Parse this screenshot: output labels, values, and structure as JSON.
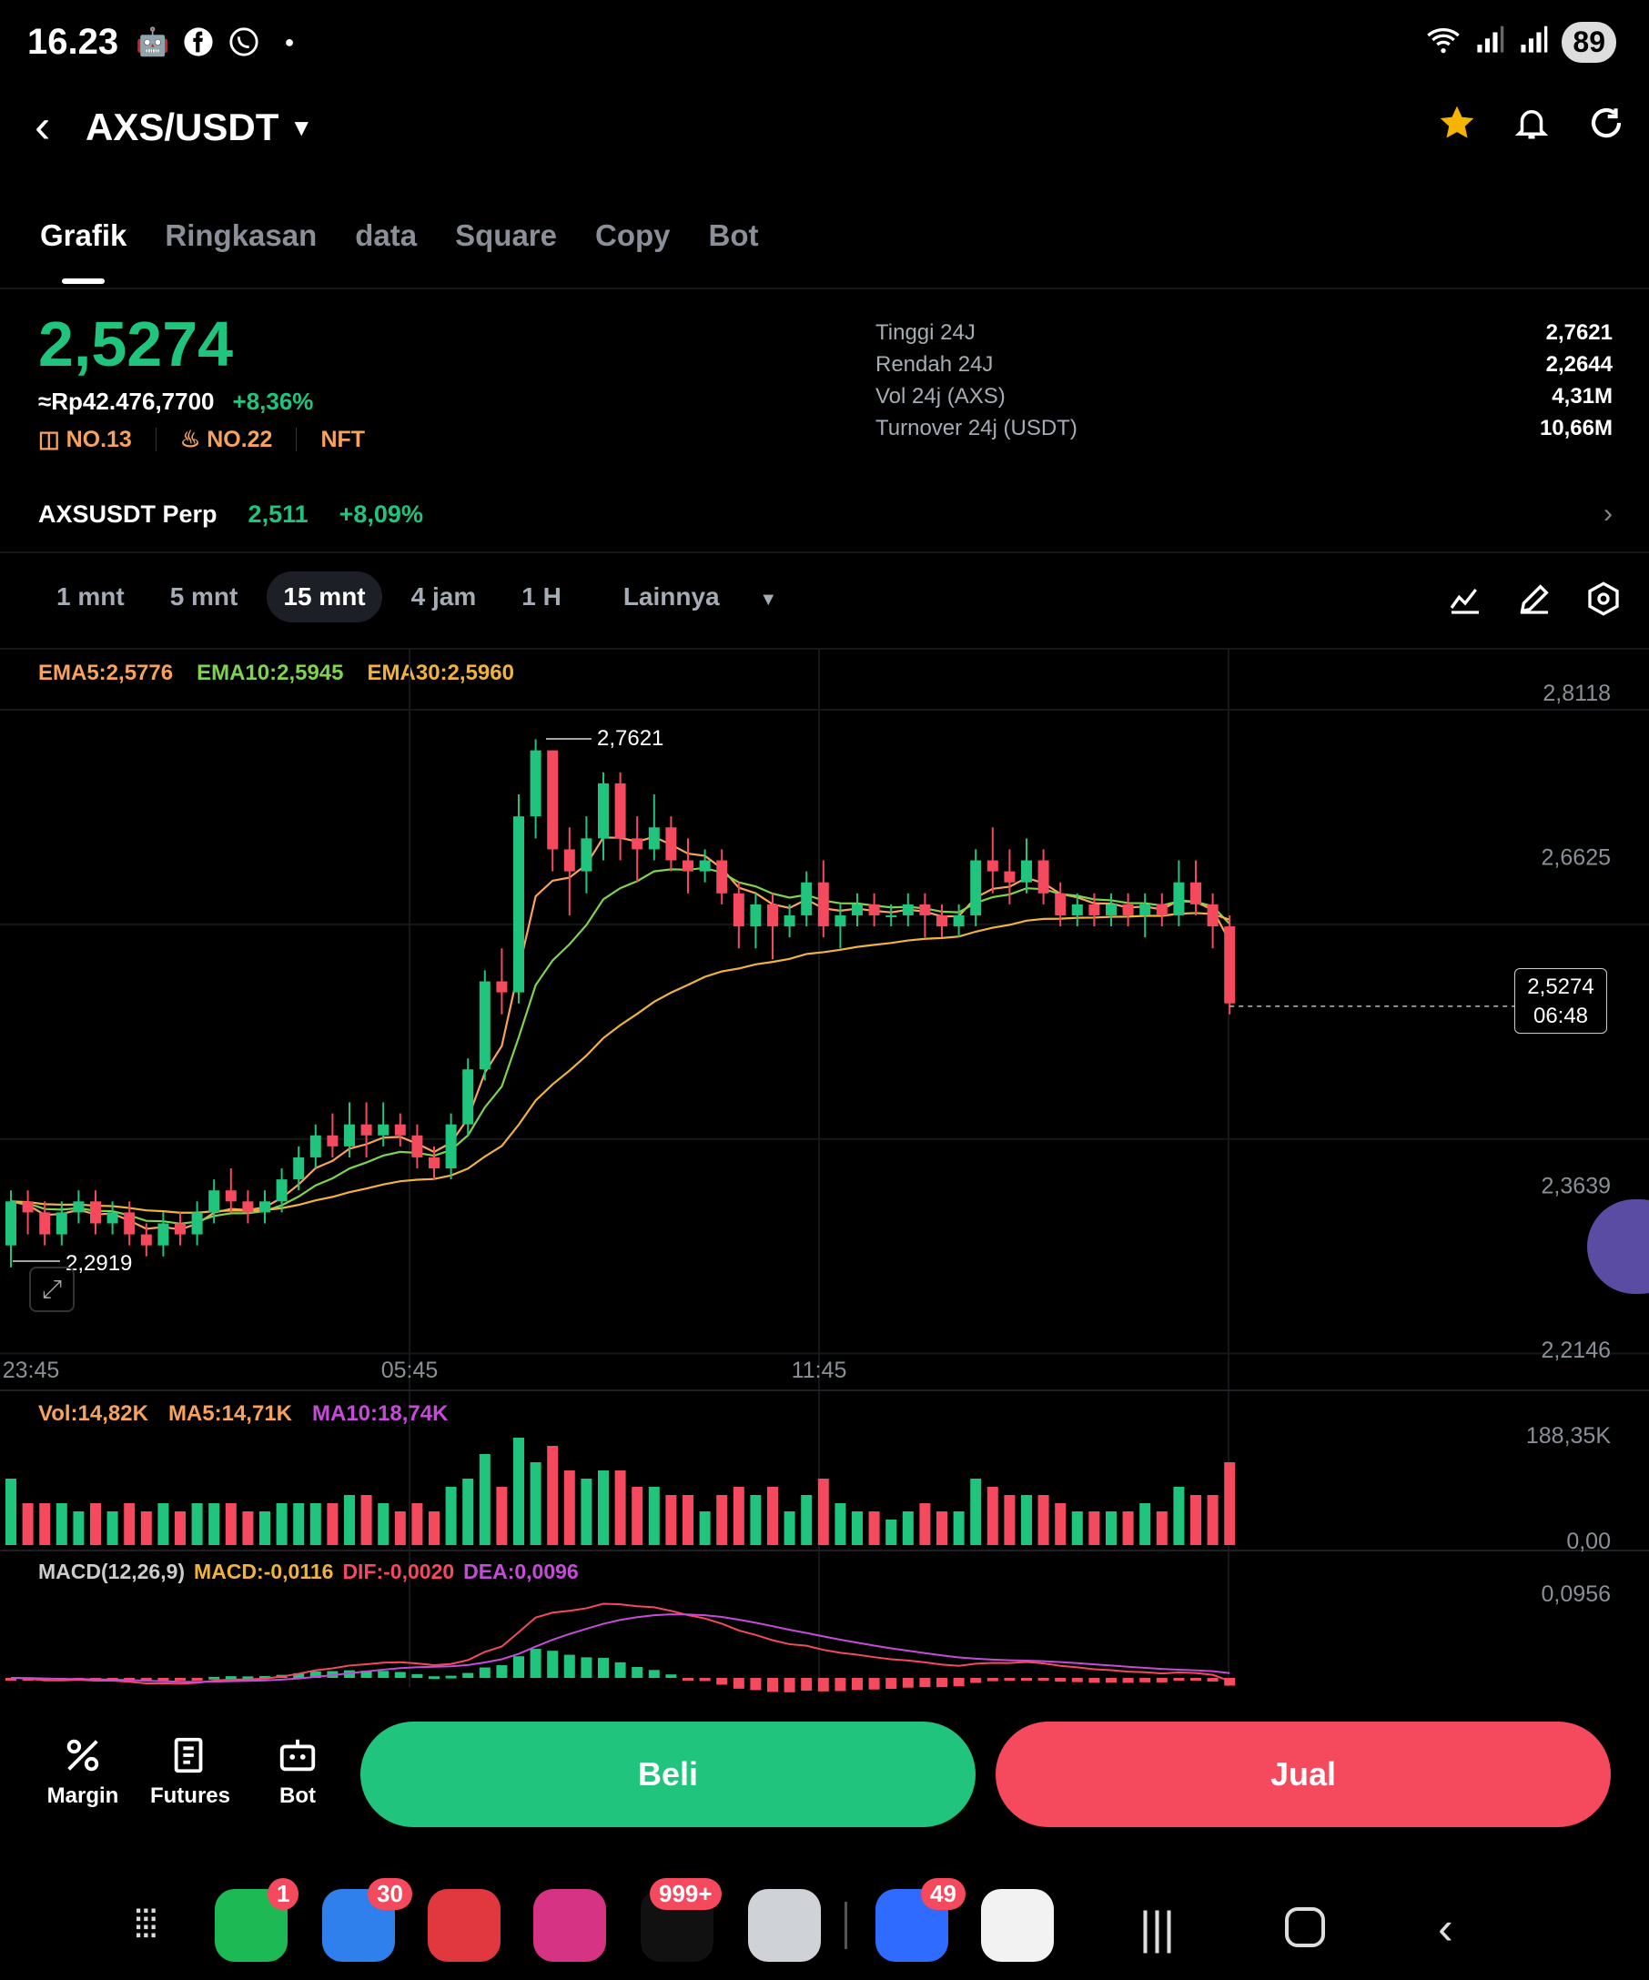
{
  "status_bar": {
    "time": "16.23",
    "battery": "89",
    "icons": [
      "bot-icon",
      "facebook-icon",
      "whatsapp-icon",
      "dot-icon"
    ],
    "right_icons": [
      "wifi-icon",
      "signal-icon",
      "signal-icon"
    ]
  },
  "header": {
    "pair": "AXS/USDT",
    "actions": [
      "star-icon",
      "bell-icon",
      "refresh-icon"
    ]
  },
  "tabs": [
    "Grafik",
    "Ringkasan",
    "data",
    "Square",
    "Copy",
    "Bot"
  ],
  "ticker": {
    "price": "2,5274",
    "fiat": "≈Rp42.476,7700",
    "change": "+8,36%",
    "rank1": "NO.13",
    "rank2": "NO.22",
    "tag": "NFT",
    "stats": [
      {
        "label": "Tinggi 24J",
        "value": "2,7621"
      },
      {
        "label": "Rendah 24J",
        "value": "2,2644"
      },
      {
        "label": "Vol 24j (AXS)",
        "value": "4,31M"
      },
      {
        "label": "Turnover 24j (USDT)",
        "value": "10,66M"
      }
    ]
  },
  "perp": {
    "name": "AXSUSDT Perp",
    "price": "2,511",
    "change": "+8,09%"
  },
  "timeframes": [
    "1 mnt",
    "5 mnt",
    "15 mnt",
    "4 jam",
    "1 H",
    "Lainnya"
  ],
  "ema_legend": {
    "ema5": "EMA5:2,5776",
    "ema10": "EMA10:2,5945",
    "ema30": "EMA30:2,5960"
  },
  "vol_legend": {
    "vol": "Vol:14,82K",
    "ma5": "MA5:14,71K",
    "ma10": "MA10:18,74K"
  },
  "macd_legend": {
    "title": "MACD(12,26,9)",
    "macd": "MACD:-0,0116",
    "dif": "DIF:-0,0020",
    "dea": "DEA:0,0096"
  },
  "colors": {
    "up": "#20c47d",
    "down": "#f5495e",
    "ema5": "#f7a35c",
    "ema10": "#7fd34e",
    "ema30": "#f0b43c",
    "ma10": "#c54bd8"
  },
  "chart_data": {
    "type": "candlestick",
    "price_axis": [
      "2,8118",
      "2,6625",
      "2,3639",
      "2,2146"
    ],
    "time_axis": [
      "23:45",
      "05:45",
      "11:45"
    ],
    "high_label": "2,7621",
    "low_label": "2,2919",
    "current_price": "2,5274",
    "current_time": "06:48",
    "volume_axis": [
      "188,35K",
      "0,00"
    ],
    "macd_axis": [
      "0,0956"
    ],
    "candles": [
      [
        2.31,
        2.35,
        2.29,
        2.36
      ],
      [
        2.35,
        2.34,
        2.32,
        2.36
      ],
      [
        2.34,
        2.32,
        2.31,
        2.35
      ],
      [
        2.32,
        2.34,
        2.31,
        2.35
      ],
      [
        2.34,
        2.35,
        2.33,
        2.36
      ],
      [
        2.35,
        2.33,
        2.32,
        2.36
      ],
      [
        2.33,
        2.34,
        2.32,
        2.35
      ],
      [
        2.34,
        2.32,
        2.31,
        2.35
      ],
      [
        2.32,
        2.31,
        2.3,
        2.33
      ],
      [
        2.31,
        2.33,
        2.3,
        2.34
      ],
      [
        2.33,
        2.32,
        2.31,
        2.34
      ],
      [
        2.32,
        2.34,
        2.31,
        2.35
      ],
      [
        2.34,
        2.36,
        2.33,
        2.37
      ],
      [
        2.36,
        2.35,
        2.34,
        2.38
      ],
      [
        2.35,
        2.34,
        2.33,
        2.36
      ],
      [
        2.34,
        2.35,
        2.33,
        2.36
      ],
      [
        2.35,
        2.37,
        2.34,
        2.38
      ],
      [
        2.37,
        2.39,
        2.36,
        2.4
      ],
      [
        2.39,
        2.41,
        2.38,
        2.42
      ],
      [
        2.41,
        2.4,
        2.39,
        2.43
      ],
      [
        2.4,
        2.42,
        2.39,
        2.44
      ],
      [
        2.42,
        2.41,
        2.39,
        2.44
      ],
      [
        2.41,
        2.42,
        2.4,
        2.44
      ],
      [
        2.42,
        2.41,
        2.4,
        2.43
      ],
      [
        2.41,
        2.39,
        2.38,
        2.42
      ],
      [
        2.39,
        2.38,
        2.37,
        2.4
      ],
      [
        2.38,
        2.42,
        2.37,
        2.43
      ],
      [
        2.42,
        2.47,
        2.41,
        2.48
      ],
      [
        2.47,
        2.55,
        2.46,
        2.56
      ],
      [
        2.55,
        2.54,
        2.52,
        2.58
      ],
      [
        2.54,
        2.7,
        2.53,
        2.72
      ],
      [
        2.7,
        2.76,
        2.68,
        2.77
      ],
      [
        2.76,
        2.67,
        2.65,
        2.76
      ],
      [
        2.67,
        2.65,
        2.61,
        2.69
      ],
      [
        2.65,
        2.68,
        2.63,
        2.7
      ],
      [
        2.68,
        2.73,
        2.66,
        2.74
      ],
      [
        2.73,
        2.68,
        2.66,
        2.74
      ],
      [
        2.68,
        2.67,
        2.64,
        2.7
      ],
      [
        2.67,
        2.69,
        2.66,
        2.72
      ],
      [
        2.69,
        2.66,
        2.65,
        2.7
      ],
      [
        2.66,
        2.65,
        2.63,
        2.68
      ],
      [
        2.65,
        2.66,
        2.64,
        2.67
      ],
      [
        2.66,
        2.63,
        2.62,
        2.67
      ],
      [
        2.63,
        2.6,
        2.58,
        2.64
      ],
      [
        2.6,
        2.62,
        2.58,
        2.63
      ],
      [
        2.62,
        2.6,
        2.57,
        2.63
      ],
      [
        2.6,
        2.61,
        2.59,
        2.62
      ],
      [
        2.61,
        2.64,
        2.6,
        2.65
      ],
      [
        2.64,
        2.6,
        2.59,
        2.66
      ],
      [
        2.6,
        2.61,
        2.58,
        2.62
      ],
      [
        2.61,
        2.62,
        2.6,
        2.63
      ],
      [
        2.62,
        2.61,
        2.6,
        2.63
      ],
      [
        2.61,
        2.61,
        2.6,
        2.62
      ],
      [
        2.61,
        2.62,
        2.6,
        2.63
      ],
      [
        2.62,
        2.61,
        2.59,
        2.63
      ],
      [
        2.61,
        2.6,
        2.59,
        2.62
      ],
      [
        2.6,
        2.61,
        2.59,
        2.62
      ],
      [
        2.61,
        2.66,
        2.6,
        2.67
      ],
      [
        2.66,
        2.65,
        2.63,
        2.69
      ],
      [
        2.65,
        2.64,
        2.62,
        2.67
      ],
      [
        2.64,
        2.66,
        2.63,
        2.68
      ],
      [
        2.66,
        2.63,
        2.62,
        2.67
      ],
      [
        2.63,
        2.61,
        2.6,
        2.64
      ],
      [
        2.61,
        2.62,
        2.6,
        2.63
      ],
      [
        2.62,
        2.61,
        2.6,
        2.63
      ],
      [
        2.61,
        2.62,
        2.6,
        2.63
      ],
      [
        2.62,
        2.61,
        2.6,
        2.63
      ],
      [
        2.61,
        2.62,
        2.59,
        2.63
      ],
      [
        2.62,
        2.61,
        2.6,
        2.63
      ],
      [
        2.61,
        2.64,
        2.6,
        2.66
      ],
      [
        2.64,
        2.62,
        2.61,
        2.66
      ],
      [
        2.62,
        2.6,
        2.58,
        2.63
      ],
      [
        2.6,
        2.53,
        2.52,
        2.61
      ]
    ]
  },
  "bottom_bar": {
    "margin": "Margin",
    "futures": "Futures",
    "bot": "Bot",
    "buy": "Beli",
    "sell": "Jual"
  },
  "dock": {
    "badges": [
      "1",
      "30",
      "999+",
      "49"
    ]
  }
}
